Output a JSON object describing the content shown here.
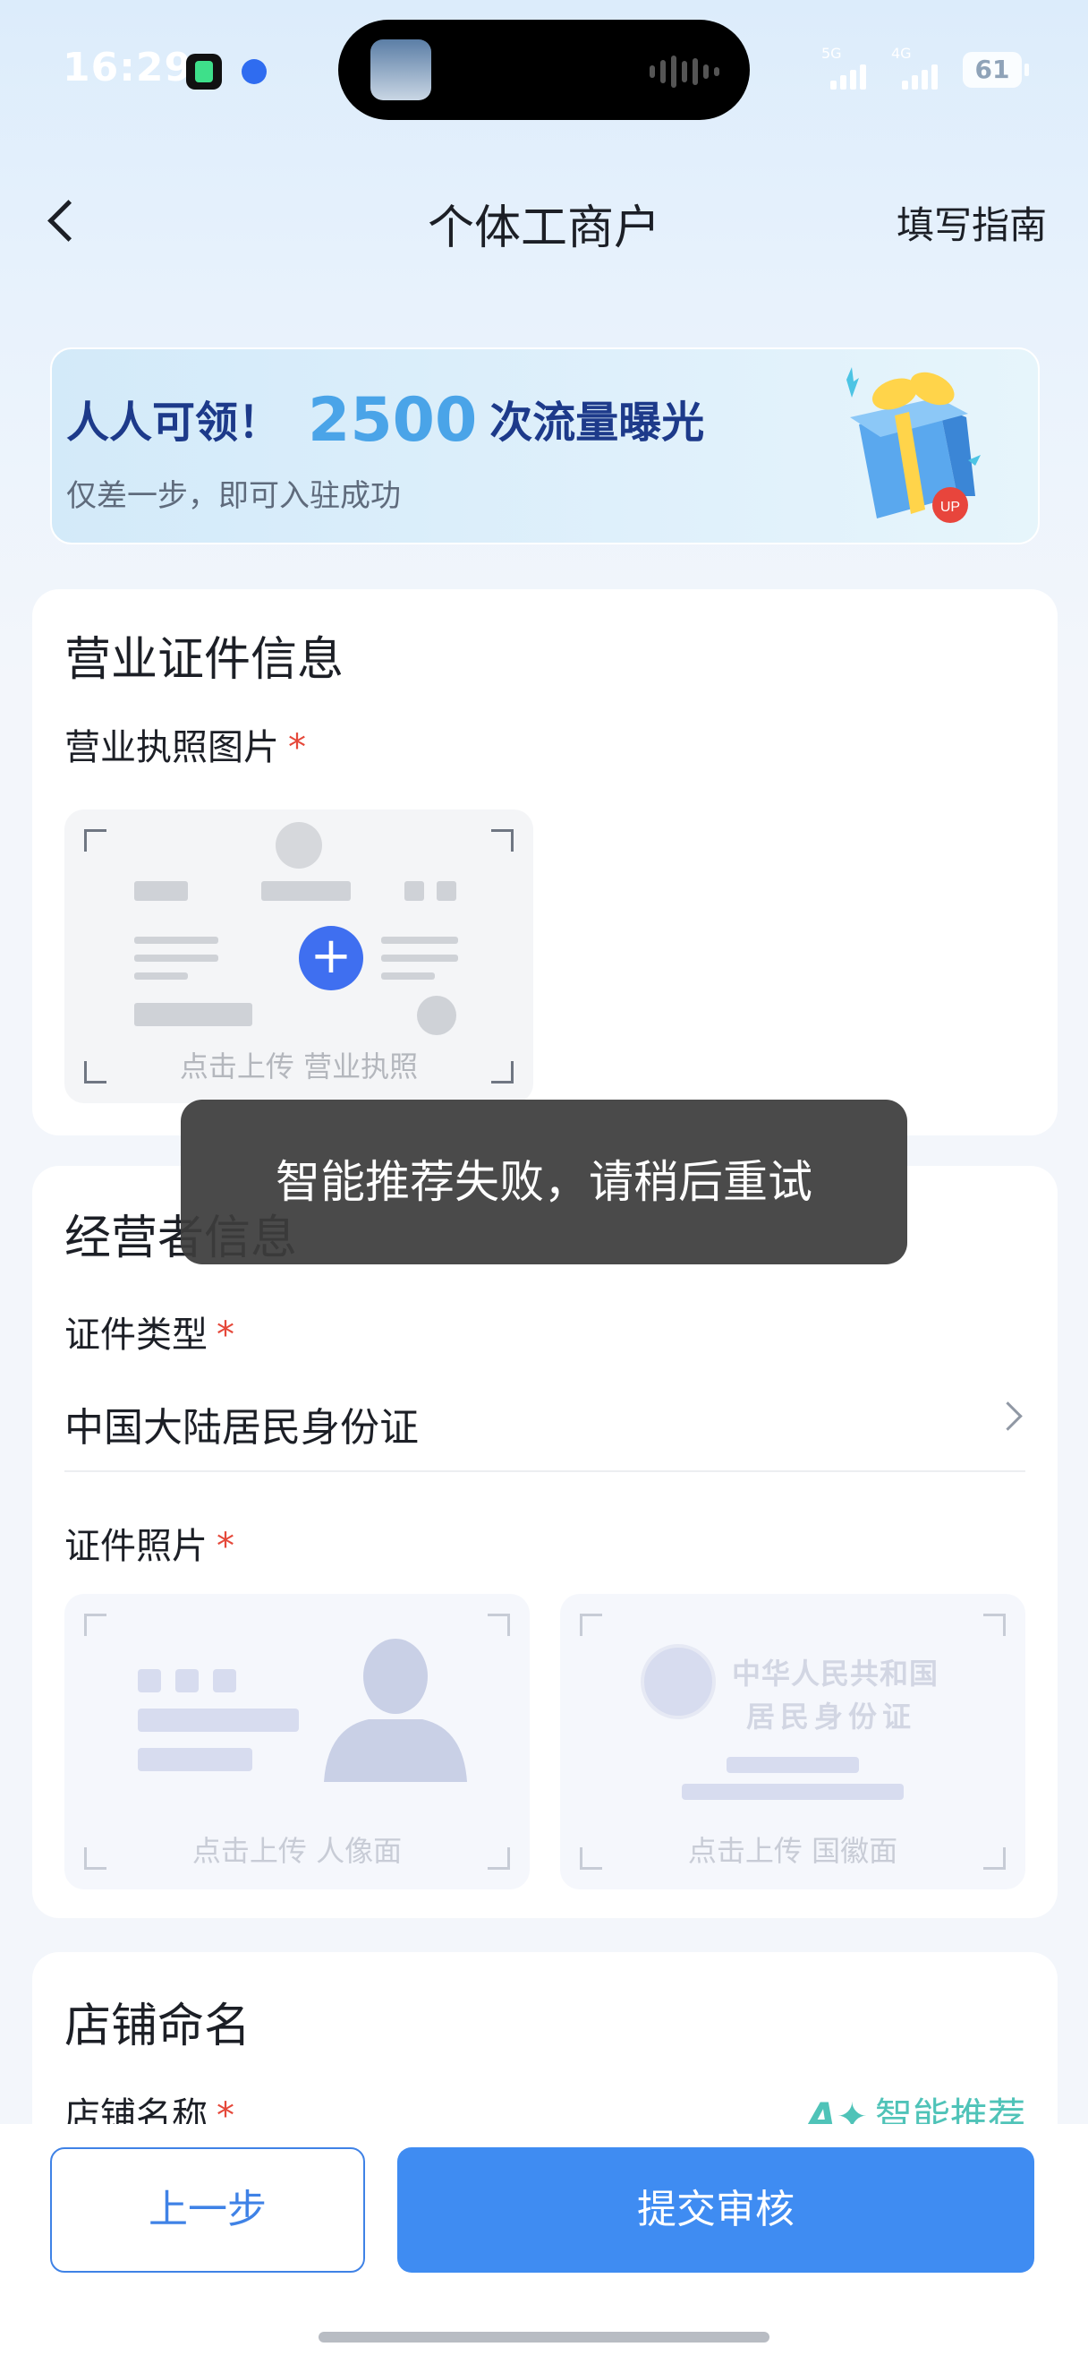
{
  "status_bar": {
    "time": "16:29",
    "network_1": "5G",
    "network_2": "4G",
    "battery": "61"
  },
  "nav": {
    "title": "个体工商户",
    "guide": "填写指南"
  },
  "banner": {
    "lead": "人人可领！",
    "number": "2500",
    "tail": "次流量曝光",
    "subtitle": "仅差一步，即可入驻成功",
    "badge": "UP"
  },
  "license_section": {
    "title": "营业证件信息",
    "image_label": "营业执照图片",
    "required_mark": "*",
    "upload_caption": "点击上传 营业执照",
    "upload_icon": "+"
  },
  "toast": {
    "message": "智能推荐失败，请稍后重试"
  },
  "operator_section": {
    "title": "经营者信息",
    "id_type_label": "证件类型",
    "id_type_value": "中国大陆居民身份证",
    "id_photo_label": "证件照片",
    "portrait_caption": "点击上传 人像面",
    "emblem_caption": "点击上传 国徽面",
    "emblem_card_line1": "中华人民共和国",
    "emblem_card_line2": "居民身份证"
  },
  "shop_section": {
    "title": "店铺命名",
    "name_label": "店铺名称",
    "ai_recommend": "智能推荐"
  },
  "footer": {
    "prev": "上一步",
    "submit": "提交审核"
  },
  "colors": {
    "primary": "#3f8cf2",
    "required": "#e5483a",
    "ai_accent": "#4fc3b8",
    "banner_number": "#4aa4e8",
    "banner_text": "#1d3a8a"
  }
}
